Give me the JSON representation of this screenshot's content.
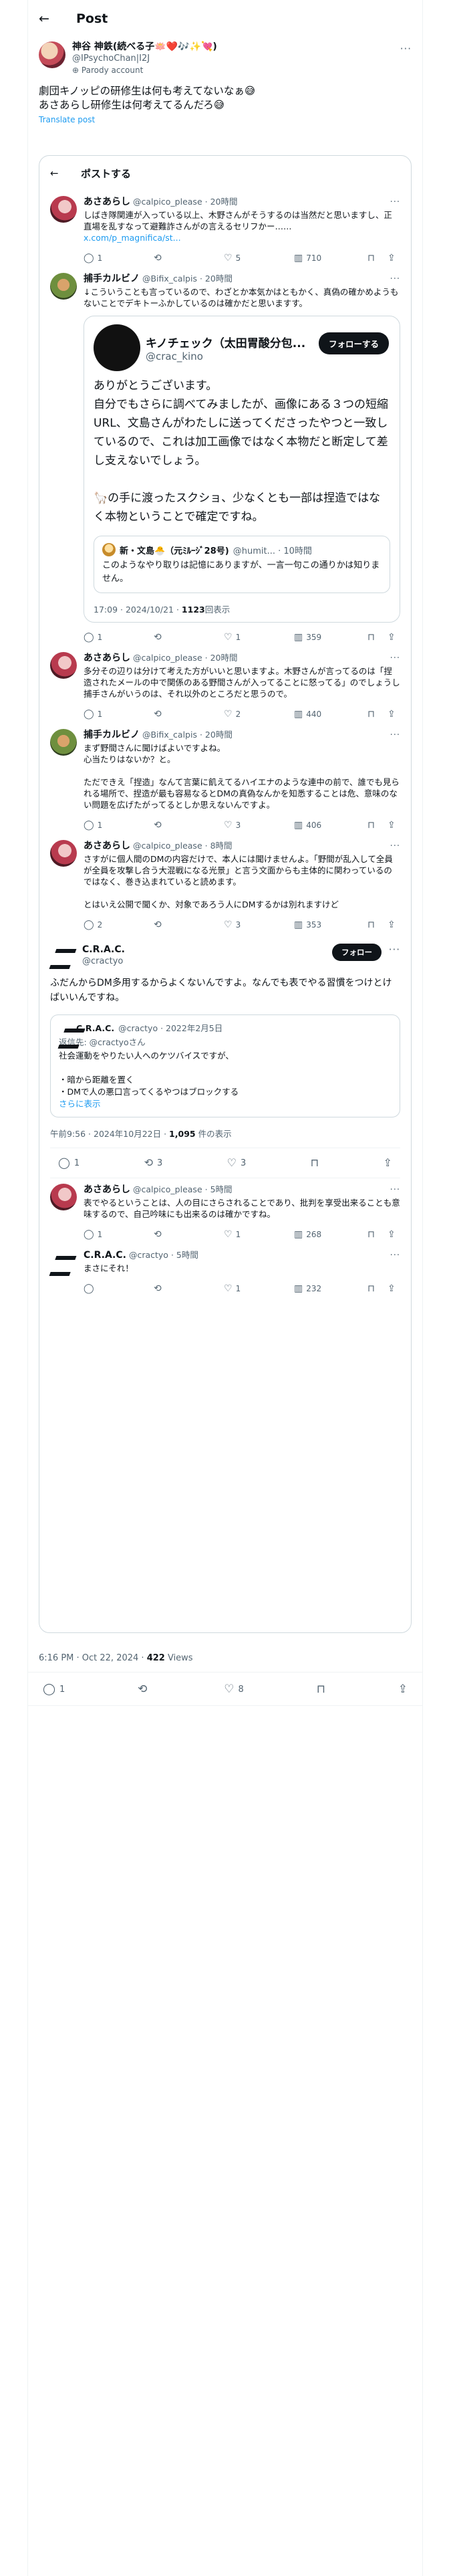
{
  "header": {
    "title": "Post"
  },
  "main_post": {
    "author_name": "神谷 神鉄(続べる子🪷❤️🎶✨💘)",
    "handle": "@IPsychoChan|I2J",
    "parody_label": "Parody account",
    "text": "劇団キノッピの研修生は何も考えてないなぁ😅\nあさあらし研修生は何考えてるんだろ😅",
    "translate": "Translate post",
    "timestamp": "6:16 PM · Oct 22, 2024 · ",
    "views_count": "422",
    "views_label": " Views",
    "actions": {
      "replies": "1",
      "retweets": "",
      "likes": "8"
    }
  },
  "quote_panel": {
    "title": "ポストする",
    "tweet1": {
      "name": "あさあらし",
      "handle": "@calpico_please",
      "time": "· 20時間",
      "text": "しばき隊関連が入っている以上、木野さんがそうするのは当然だと思いますし、正直場を乱すなって避難詐さんがの言えるセリフかー……",
      "link": "x.com/p_magnifica/st...",
      "replies": "1",
      "retweets": "",
      "likes": "5",
      "views": "710"
    },
    "tweet2": {
      "name": "捕手カルビノ",
      "handle": "@Bifix_calpis",
      "time": "· 20時間",
      "text": "↓こういうことも言っているので、わざとか本気かはともかく、真偽の確かめようもないことでデキトーふかしているのは確かだと思いますす。"
    },
    "big_quote": {
      "name": "キノチェック（太田胃酸分包...",
      "handle": "@crac_kino",
      "follow": "フォローする",
      "text": "ありがとうございます。\n自分でもさらに調べてみましたが、画像にある３つの短縮URL、文島さんがわたしに送ってくださったやつと一致しているので、これは加工画像ではなく本物だと断定して差し支えないでしょう。\n\n🦙の手に渡ったスクショ、少なくとも一部は捏造ではなく本物ということで確定ですね。",
      "inner_name": "新・文島🐣（元ﾐﾙｰｼﾞ28号)",
      "inner_handle": "@humit... · 10時間",
      "inner_text": "このようなやり取りは記憶にありますが、一言一句この通りかは知りません。",
      "date": "17:09 · 2024/10/21 · ",
      "views_count": "1123",
      "views_label": "回表示"
    },
    "tweet2_actions": {
      "replies": "1",
      "retweets": "",
      "likes": "1",
      "views": "359"
    },
    "tweet3": {
      "name": "あさあらし",
      "handle": "@calpico_please",
      "time": "· 20時間",
      "text": "多分その辺りは分けて考えた方がいいと思いますよ。木野さんが言ってるのは「捏造されたメールの中で関係のある野間さんが入ってることに怒ってる」のでしょうし\n捕手さんがいうのは、それ以外のところだと思うので。",
      "replies": "1",
      "retweets": "",
      "likes": "2",
      "views": "440"
    },
    "tweet4": {
      "name": "捕手カルビノ",
      "handle": "@Bifix_calpis",
      "time": "· 20時間",
      "text": "まず野間さんに聞けばよいですよね。\n心当たりはないか？と。\n\nただできえ「捏造」なんて言葉に飢えてるハイエナのような連中の前で、誰でも見られる場所で、捏造が最も容易なるとDMの真偽なんかを知悉することは危、意味のない問題を広げたがってるとしか思えないんですよ。",
      "replies": "1",
      "retweets": "",
      "likes": "3",
      "views": "406"
    },
    "tweet5": {
      "name": "あさあらし",
      "handle": "@calpico_please",
      "time": "· 8時間",
      "text": "さすがに個人間のDMの内容だけで、本人には聞けませんよ。「野間が乱入して全員が全員を攻撃し合う大混戦になる光景」と言う文面からも主体的に関わっているのではなく、巻き込まれていると読めます。\n\nとはいえ公開で聞くか、対象であろう人にDMするかは別れますけど",
      "replies": "2",
      "retweets": "",
      "likes": "3",
      "views": "353"
    },
    "crac": {
      "name": "C.R.A.C.",
      "handle": "@cractyo",
      "follow": "フォロー",
      "text": "ふだんからDM多用するからよくないんですよ。なんでも表でやる習慣をつけとけばいいんですね。",
      "quote_name": "C.R.A.C.",
      "quote_handle": "@cractyo · 2022年2月5日",
      "quote_reply": "返信先: @cractyoさん",
      "quote_text": "社会運動をやりたい人へのケツバイスですが、\n\n・暗から距離を置く\n・DMで人の悪口言ってくるやつはブロックする",
      "quote_more": "さらに表示",
      "date": "午前9:56 · 2024年10月22日 · ",
      "views_count": "1,095",
      "views_label": " 件の表示",
      "replies": "1",
      "retweets": "3",
      "likes": "3"
    },
    "tweet6": {
      "name": "あさあらし",
      "handle": "@calpico_please",
      "time": "· 5時間",
      "text": "表でやるということは、人の目にさらされることであり、批判を享受出来ることも意味するので、自己吟味にも出来るのは確かですね。",
      "replies": "1",
      "retweets": "",
      "likes": "1",
      "views": "268"
    },
    "tweet7": {
      "name": "C.R.A.C.",
      "handle": "@cractyo",
      "time": "· 5時間",
      "text": "まさにそれ！",
      "replies": "",
      "retweets": "",
      "likes": "1",
      "views": "232"
    }
  },
  "icons": {
    "back": "←",
    "reply": "◯",
    "retweet": "⟲",
    "like": "♡",
    "views": "▥",
    "bookmark": "⊓",
    "share": "⇪",
    "more": "···",
    "badge": "⊕"
  }
}
